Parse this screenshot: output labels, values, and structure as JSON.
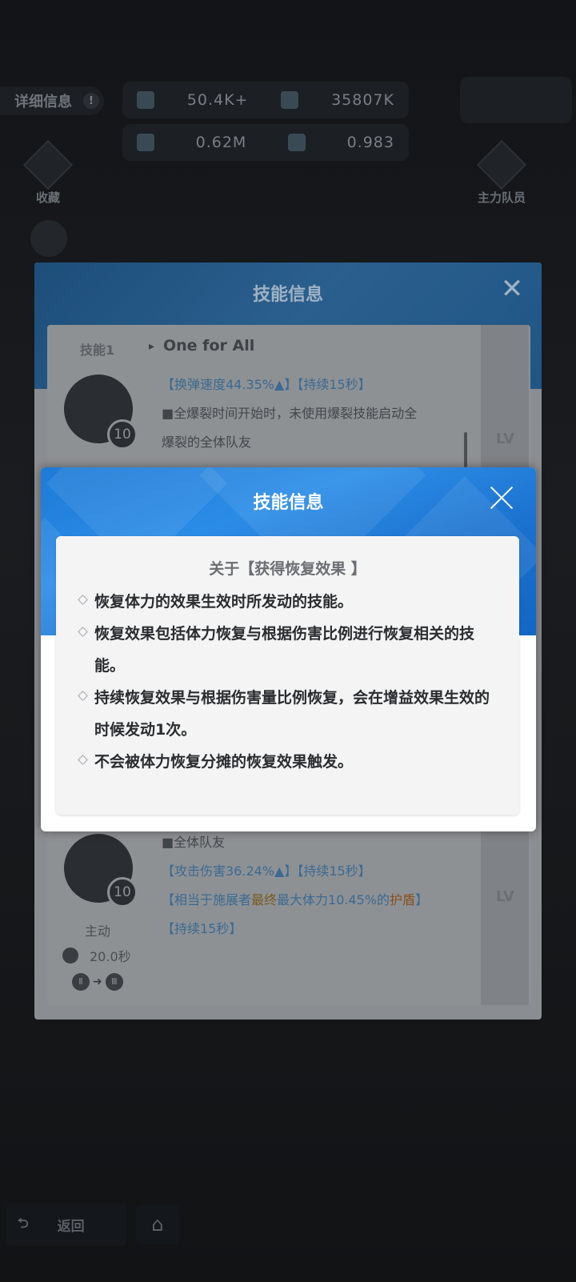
{
  "hud": {
    "info_label": "详细信息",
    "info_icon": "info-icon",
    "stat_1a": "50.4K+",
    "stat_1b": "35807K",
    "stat_2a": "0.62M",
    "stat_2b": "0.983",
    "badge_left": "收藏",
    "badge_right": "主力队员"
  },
  "back_dialog": {
    "title": "技能信息",
    "skill1": {
      "label": "技能1",
      "name": "One for All",
      "level": "10",
      "line1": "【换弹速度44.35%▲】【持续15秒】",
      "line2": "■全爆裂时间开始时，未使用爆裂技能启动全",
      "line3": "爆裂的全体队友",
      "maxlv": "LV"
    },
    "skill2": {
      "level": "10",
      "line1": "■全体队友",
      "line2": "【攻击伤害36.24%▲】【持续15秒】",
      "line3_a": "【相当于施展者",
      "line3_b": "最终",
      "line3_c": "最大体力10.45%的",
      "line3_d": "护盾",
      "line3_e": "】",
      "line4": "【持续15秒】",
      "maxlv": "LV",
      "type": "主动",
      "cooldown": "20.0秒"
    }
  },
  "front_dialog": {
    "title": "技能信息",
    "heading": "关于【获得恢复效果 】",
    "bullets": [
      "恢复体力的效果生效时所发动的技能。",
      "恢复效果包括体力恢复与根据伤害比例进行恢复相关的技能。",
      "持续恢复效果与根据伤害量比例恢复，会在增益效果生效的时候发动1次。",
      "不会被体力恢复分摊的恢复效果触发。"
    ]
  },
  "bottom": {
    "back_label": "返回",
    "home_icon": "home-icon"
  }
}
